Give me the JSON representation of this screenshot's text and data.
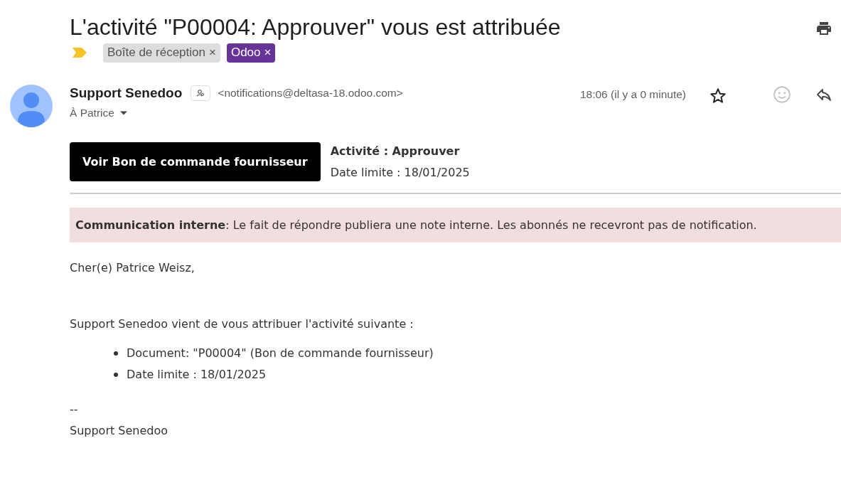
{
  "subject": "L'activité \"P00004: Approuver\" vous est attribuée",
  "labels": [
    {
      "text": "Boîte de réception",
      "color": "#dddddd"
    },
    {
      "text": "Odoo",
      "color": "#663399"
    }
  ],
  "label_close": "×",
  "important": true,
  "sender": {
    "name": "Support Senedoo",
    "email": "<notifications@deltasa-18.odoo.com>"
  },
  "recipient": "À Patrice",
  "time": "18:06 (il y a 0 minute)",
  "starred": false,
  "action_button": "Voir Bon de commande fournisseur",
  "activity": "Activité : Approuver",
  "deadline": "Date limite : 18/01/2025",
  "notice": "**Communication interne**: Le fait de répondre publiera une note interne. Les abonnés ne recevront pas de notification.",
  "greeting": "Cher(e) Patrice Weisz,",
  "intro": "Support Senedoo vient de vous attribuer l'activité suivante :",
  "bullets": [
    "Document: \"P00004\" (Bon de commande fournisseur)",
    "Date limite : 18/01/2025"
  ],
  "signature_separator": "--",
  "signature": "Support Senedoo"
}
